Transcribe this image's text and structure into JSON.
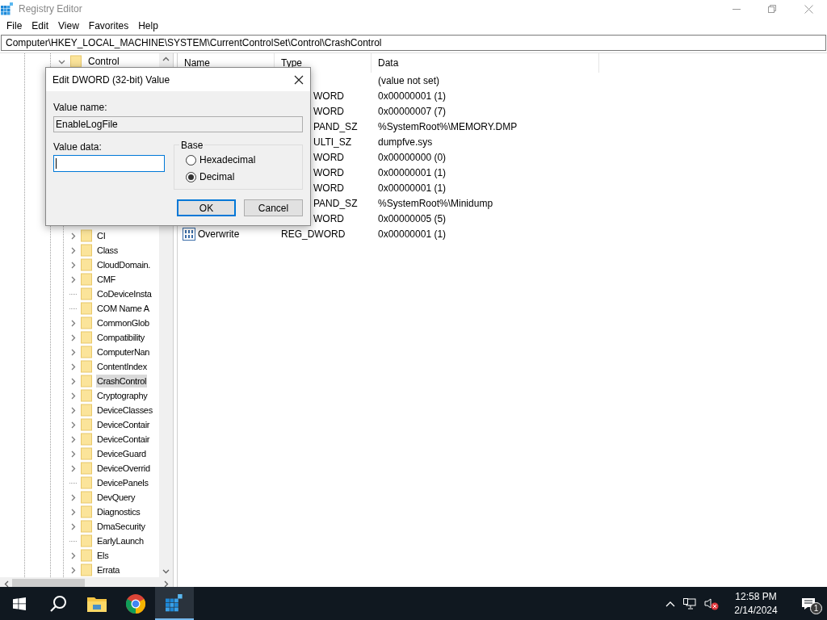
{
  "window": {
    "title": "Registry Editor"
  },
  "menu": [
    "File",
    "Edit",
    "View",
    "Favorites",
    "Help"
  ],
  "address": "Computer\\HKEY_LOCAL_MACHINE\\SYSTEM\\CurrentControlSet\\Control\\CrashControl",
  "tree": {
    "label": "Control",
    "expanded": true,
    "children": [
      {
        "label": "CI",
        "has_children": true,
        "selected": false
      },
      {
        "label": "Class",
        "has_children": true,
        "selected": false
      },
      {
        "label": "CloudDomain.",
        "has_children": true,
        "selected": false
      },
      {
        "label": "CMF",
        "has_children": true,
        "selected": false
      },
      {
        "label": "CoDeviceInsta",
        "has_children": false,
        "selected": false
      },
      {
        "label": "COM Name A",
        "has_children": false,
        "selected": false
      },
      {
        "label": "CommonGlob",
        "has_children": true,
        "selected": false
      },
      {
        "label": "Compatibility",
        "has_children": true,
        "selected": false
      },
      {
        "label": "ComputerNan",
        "has_children": true,
        "selected": false
      },
      {
        "label": "ContentIndex",
        "has_children": true,
        "selected": false
      },
      {
        "label": "CrashControl",
        "has_children": true,
        "selected": true
      },
      {
        "label": "Cryptography",
        "has_children": true,
        "selected": false
      },
      {
        "label": "DeviceClasses",
        "has_children": true,
        "selected": false
      },
      {
        "label": "DeviceContair",
        "has_children": true,
        "selected": false
      },
      {
        "label": "DeviceContair",
        "has_children": true,
        "selected": false
      },
      {
        "label": "DeviceGuard",
        "has_children": true,
        "selected": false
      },
      {
        "label": "DeviceOverrid",
        "has_children": true,
        "selected": false
      },
      {
        "label": "DevicePanels",
        "has_children": false,
        "selected": false
      },
      {
        "label": "DevQuery",
        "has_children": true,
        "selected": false
      },
      {
        "label": "Diagnostics",
        "has_children": true,
        "selected": false
      },
      {
        "label": "DmaSecurity",
        "has_children": true,
        "selected": false
      },
      {
        "label": "EarlyLaunch",
        "has_children": false,
        "selected": false
      },
      {
        "label": "Els",
        "has_children": true,
        "selected": false
      },
      {
        "label": "Errata",
        "has_children": true,
        "selected": false
      }
    ]
  },
  "list": {
    "columns": [
      "Name",
      "Type",
      "Data"
    ],
    "rows": [
      {
        "data": "(value not set)"
      },
      {
        "type": "WORD",
        "clipped": true,
        "data": "0x00000001 (1)"
      },
      {
        "type": "WORD",
        "clipped": true,
        "data": "0x00000007 (7)"
      },
      {
        "type": "PAND_SZ",
        "clipped": true,
        "data": "%SystemRoot%\\MEMORY.DMP"
      },
      {
        "type": "ULTI_SZ",
        "clipped": true,
        "data": "dumpfve.sys"
      },
      {
        "type": "WORD",
        "clipped": true,
        "data": "0x00000000 (0)"
      },
      {
        "type": "WORD",
        "clipped": true,
        "data": "0x00000001 (1)"
      },
      {
        "type": "WORD",
        "clipped": true,
        "data": "0x00000001 (1)"
      },
      {
        "type": "PAND_SZ",
        "clipped": true,
        "data": "%SystemRoot%\\Minidump"
      },
      {
        "type": "WORD",
        "clipped": true,
        "data": "0x00000005 (5)"
      },
      {
        "kind": "binary",
        "name": "Overwrite",
        "type": "REG_DWORD",
        "clipped": false,
        "data": "0x00000001 (1)"
      }
    ]
  },
  "dialog": {
    "title": "Edit DWORD (32-bit) Value",
    "name_label": "Value name:",
    "name_value": "EnableLogFile",
    "data_label": "Value data:",
    "base_label": "Base",
    "bases": [
      {
        "label": "Hexadecimal",
        "selected": false
      },
      {
        "label": "Decimal",
        "selected": true
      }
    ],
    "buttons": [
      {
        "label": "OK",
        "default": true
      },
      {
        "label": "Cancel",
        "default": false
      }
    ]
  },
  "taskbar": {
    "apps": [
      {
        "kind": "folder",
        "active": false
      },
      {
        "kind": "chrome",
        "active": false
      },
      {
        "kind": "regedit",
        "active": true
      }
    ],
    "time": "12:58 PM",
    "date": "2/14/2024",
    "notifications": "1"
  }
}
